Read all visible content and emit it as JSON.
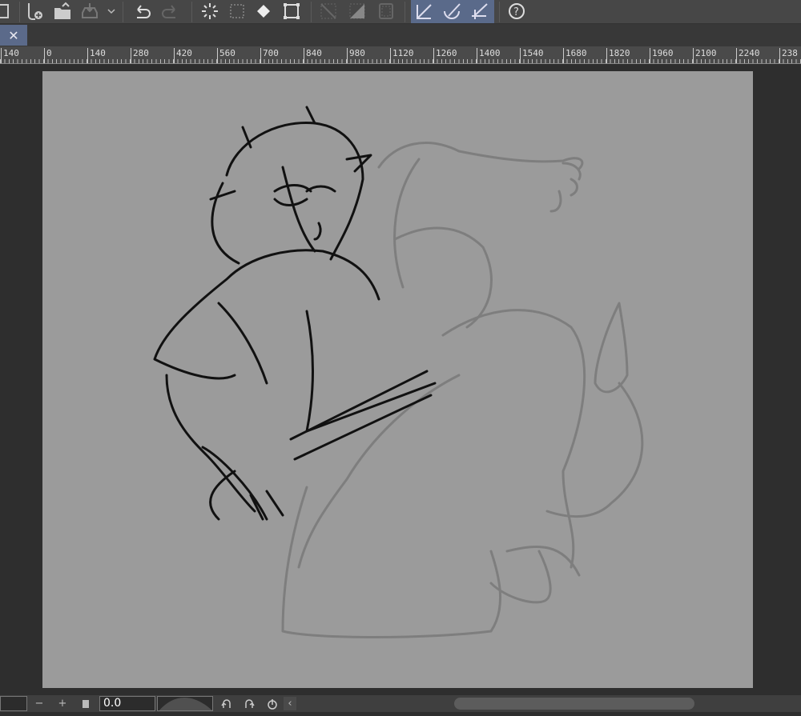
{
  "tabs": {
    "close_label": "✕"
  },
  "ruler": {
    "labels": [
      "140",
      "0",
      "140",
      "280",
      "420",
      "560",
      "700",
      "840",
      "980",
      "1120",
      "1260",
      "1400",
      "1540",
      "1680",
      "1820",
      "1960",
      "2100",
      "2240",
      "238"
    ]
  },
  "bottom": {
    "minus": "−",
    "plus": "+",
    "angle_value": "0.0",
    "collapse": "‹"
  },
  "colors": {
    "canvas": "#9b9b9b",
    "accent": "#5b6a8a"
  }
}
